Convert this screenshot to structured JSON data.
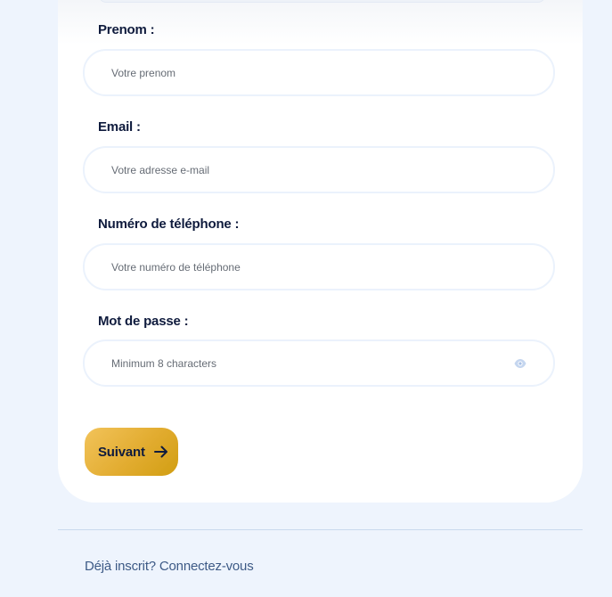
{
  "form": {
    "fields": [
      {
        "label": "Prenom :",
        "placeholder": "Votre prenom",
        "value": ""
      },
      {
        "label": "Email :",
        "placeholder": "Votre adresse e-mail",
        "value": ""
      },
      {
        "label": "Numéro de téléphone :",
        "placeholder": "Votre numéro de téléphone",
        "value": ""
      },
      {
        "label": "Mot de passe :",
        "placeholder": "Minimum 8 characters",
        "value": ""
      }
    ],
    "next_button_label": "Suivant"
  },
  "footer": {
    "question": "Déjà inscrit?",
    "link_text": "Connectez-vous"
  },
  "icons": {
    "password_toggle": "eye-icon",
    "next_arrow": "arrow-right-icon"
  },
  "colors": {
    "page_background": "#eef4fd",
    "card_background": "#ffffff",
    "label_text": "#0f1b3d",
    "button_gradient_start": "#f2c35a",
    "button_gradient_end": "#d19e12",
    "link_text": "#3d5a86"
  }
}
